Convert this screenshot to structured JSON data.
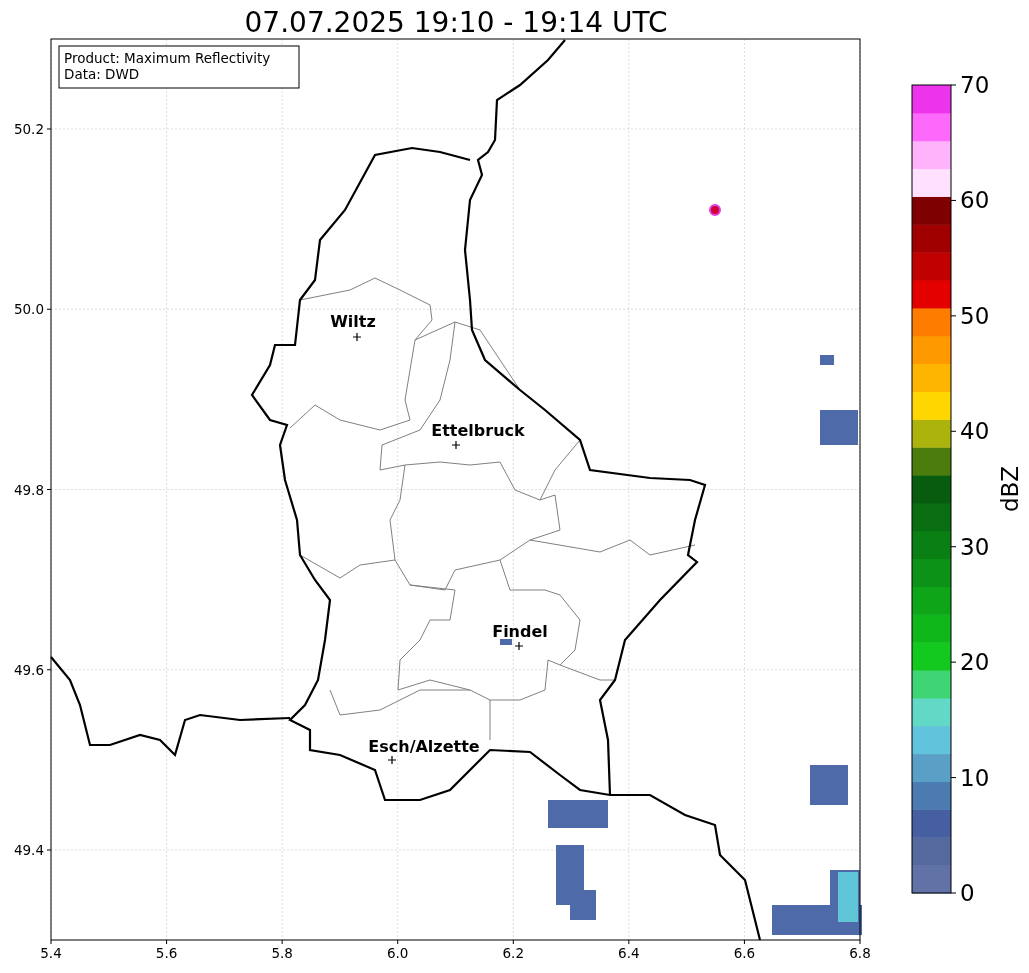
{
  "title": "07.07.2025 19:10 - 19:14 UTC",
  "info": [
    "Product: Maximum Reflectivity",
    "Data: DWD"
  ],
  "cities": [
    {
      "name": "Wiltz"
    },
    {
      "name": "Ettelbruck"
    },
    {
      "name": "Findel"
    },
    {
      "name": "Esch/Alzette"
    }
  ],
  "x_ticks": [
    "5.4",
    "5.6",
    "5.8",
    "6.0",
    "6.2",
    "6.4",
    "6.6",
    "6.8"
  ],
  "y_ticks": [
    "50.2",
    "50.0",
    "49.8",
    "49.6",
    "49.4"
  ],
  "colorbar": {
    "label": "dBZ",
    "ticks": [
      "70",
      "60",
      "50",
      "40",
      "30",
      "20",
      "10",
      "0"
    ],
    "bins": [
      {
        "color": "#6072a6"
      },
      {
        "color": "#56699f"
      },
      {
        "color": "#455fa0"
      },
      {
        "color": "#4b7bb1"
      },
      {
        "color": "#5aa0c6"
      },
      {
        "color": "#62c3dc"
      },
      {
        "color": "#62d8c6"
      },
      {
        "color": "#3fd574"
      },
      {
        "color": "#13c91f"
      },
      {
        "color": "#10b71b"
      },
      {
        "color": "#0ea518"
      },
      {
        "color": "#0c9216"
      },
      {
        "color": "#0a8014"
      },
      {
        "color": "#096e12"
      },
      {
        "color": "#085c10"
      },
      {
        "color": "#4c7c0c"
      },
      {
        "color": "#acb30d"
      },
      {
        "color": "#fed700"
      },
      {
        "color": "#feb500"
      },
      {
        "color": "#fe9a00"
      },
      {
        "color": "#fe7d00"
      },
      {
        "color": "#e50000"
      },
      {
        "color": "#c10000"
      },
      {
        "color": "#a00000"
      },
      {
        "color": "#7f0000"
      },
      {
        "color": "#ffe0fe"
      },
      {
        "color": "#ffb3fb"
      },
      {
        "color": "#fd69fb"
      },
      {
        "color": "#ec34ed"
      }
    ]
  }
}
